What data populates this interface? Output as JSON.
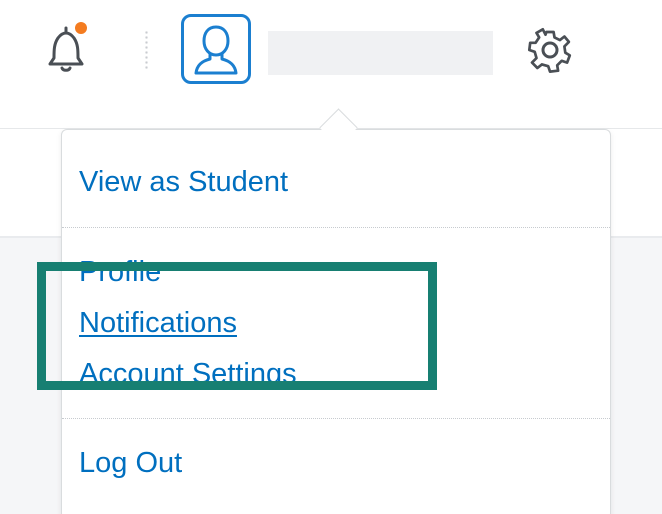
{
  "menu": {
    "view_as_student": "View as Student",
    "profile": "Profile",
    "notifications": "Notifications",
    "account_settings": "Account Settings",
    "log_out": "Log Out"
  },
  "colors": {
    "link": "#006fbf",
    "avatar_border": "#1b7fd0",
    "notification_dot": "#f47c20",
    "highlight": "#177f72"
  },
  "icons": {
    "bell": "bell-icon",
    "avatar": "user-avatar-icon",
    "gear": "gear-icon"
  }
}
